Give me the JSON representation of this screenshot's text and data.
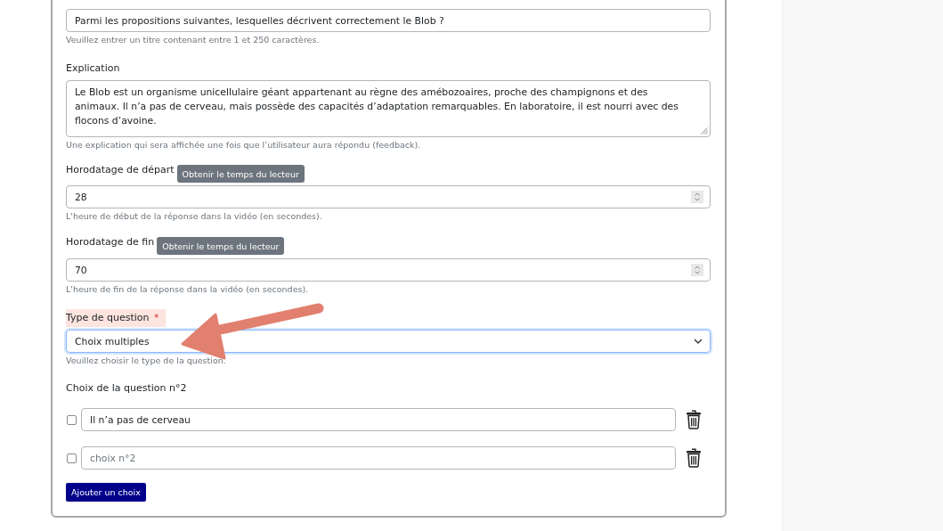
{
  "form": {
    "fields": [
      {
        "kind": "text",
        "value": "Parmi les propositions suivantes, lesquelles décrivent correctement le Blob ?",
        "help": "Veuillez entrer un titre contenant entre 1 et 250 caractères."
      },
      {
        "kind": "textarea",
        "label": "Explication",
        "value": "Le Blob est un organisme unicellulaire géant appartenant au règne des amébozoaires, proche des champignons et des animaux. Il n’a pas de cerveau, mais possède des capacités d’adaptation remarquables. En laboratoire, il est nourri avec des flocons d’avoine.",
        "help": "Une explication qui sera affichée une fois que l’utilisateur aura répondu (feedback)."
      },
      {
        "kind": "number",
        "label": "Horodatage de départ",
        "button": "Obtenir le temps du lecteur",
        "value": "28",
        "help": "L'heure de début de la réponse dans la vidéo (en secondes)."
      },
      {
        "kind": "number",
        "label": "Horodatage de fin",
        "button": "Obtenir le temps du lecteur",
        "value": "70",
        "help": "L'heure de fin de la réponse dans la vidéo (en secondes)."
      },
      {
        "kind": "select",
        "label": "Type de question",
        "required_mark": "*",
        "highlighted": true,
        "focused": true,
        "value": "Choix multiples",
        "help": "Veuillez choisir le type de la question."
      }
    ],
    "choices": {
      "title": "Choix de la question n°2",
      "items": [
        {
          "checked": false,
          "value": "Il n’a pas de cerveau"
        },
        {
          "checked": false,
          "placeholder": "choix n°2"
        }
      ],
      "add_button": "Ajouter un choix"
    }
  },
  "annotation": {
    "kind": "arrow"
  }
}
